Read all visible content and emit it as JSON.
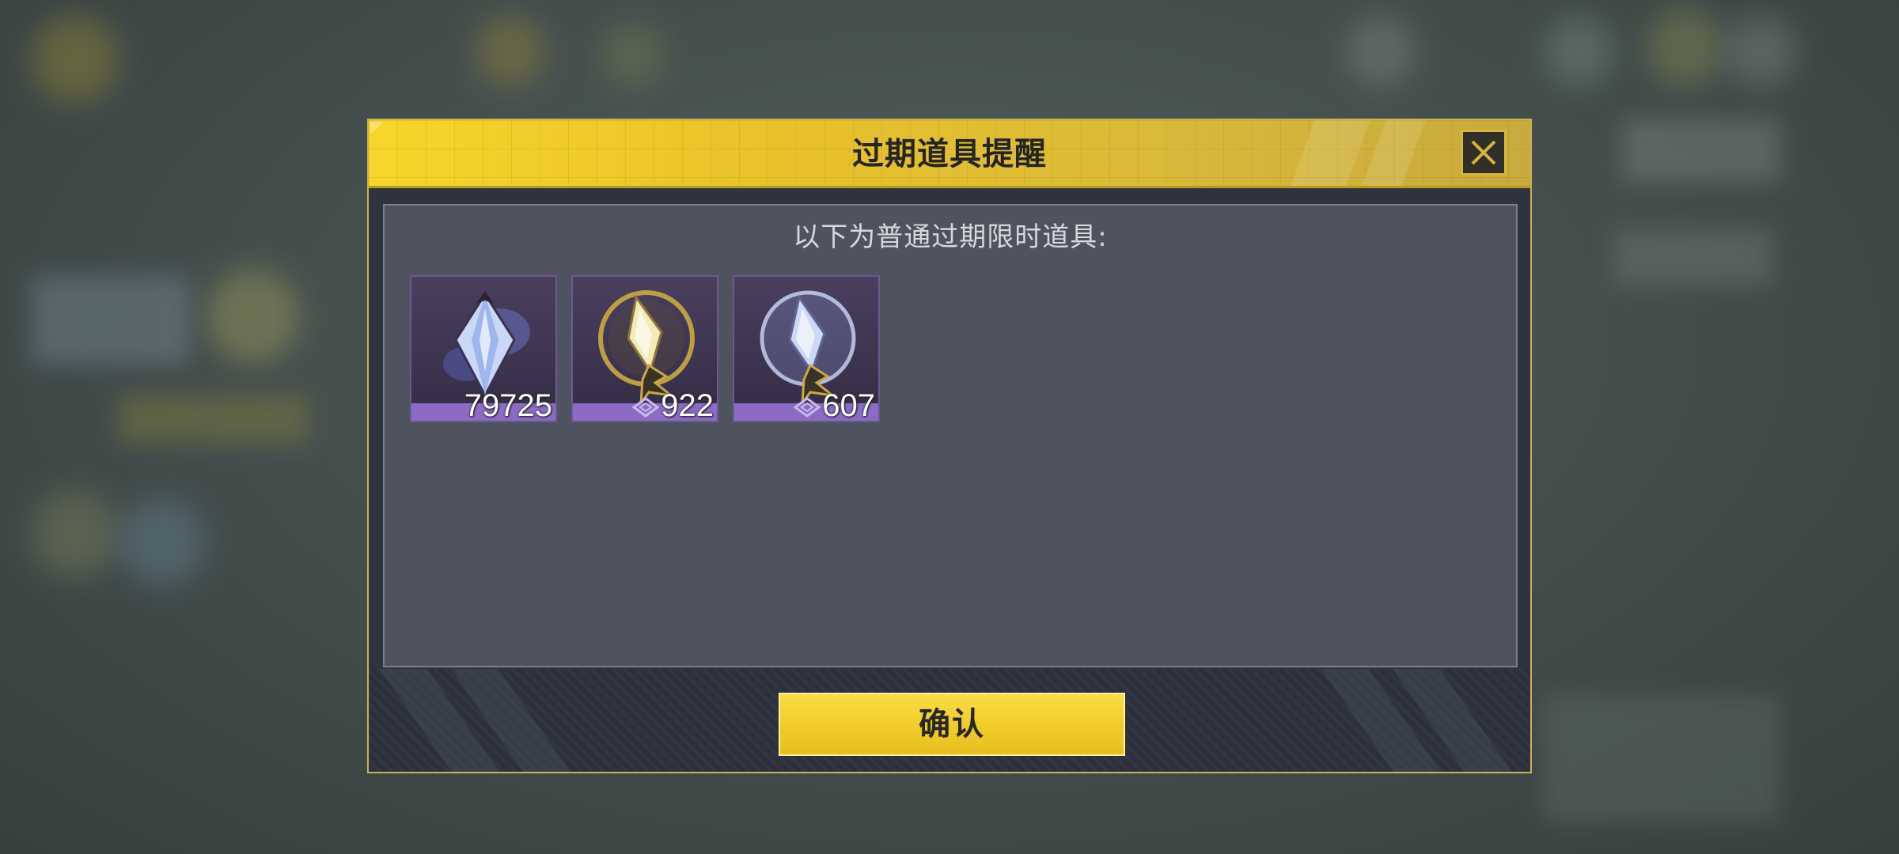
{
  "dialog": {
    "title": "过期道具提醒",
    "subtitle": "以下为普通过期限时道具:",
    "confirm_label": "确认",
    "items": [
      {
        "name": "crystal-shard",
        "quantity": "79725",
        "has_diamond_mark": false
      },
      {
        "name": "golden-spearhead",
        "quantity": "922",
        "has_diamond_mark": true
      },
      {
        "name": "silver-spearhead",
        "quantity": "607",
        "has_diamond_mark": true
      }
    ]
  },
  "colors": {
    "header_gold": "#f6d62a",
    "panel_bg": "#4f5360",
    "dialog_bg": "#2f3340",
    "item_bg": "#3d3450",
    "item_quantity_bar": "#8c6bc4",
    "confirm_button": "#f0cc2a"
  },
  "icons": {
    "close": "close-x-icon",
    "quantity_mark": "diamond-outline-icon"
  }
}
